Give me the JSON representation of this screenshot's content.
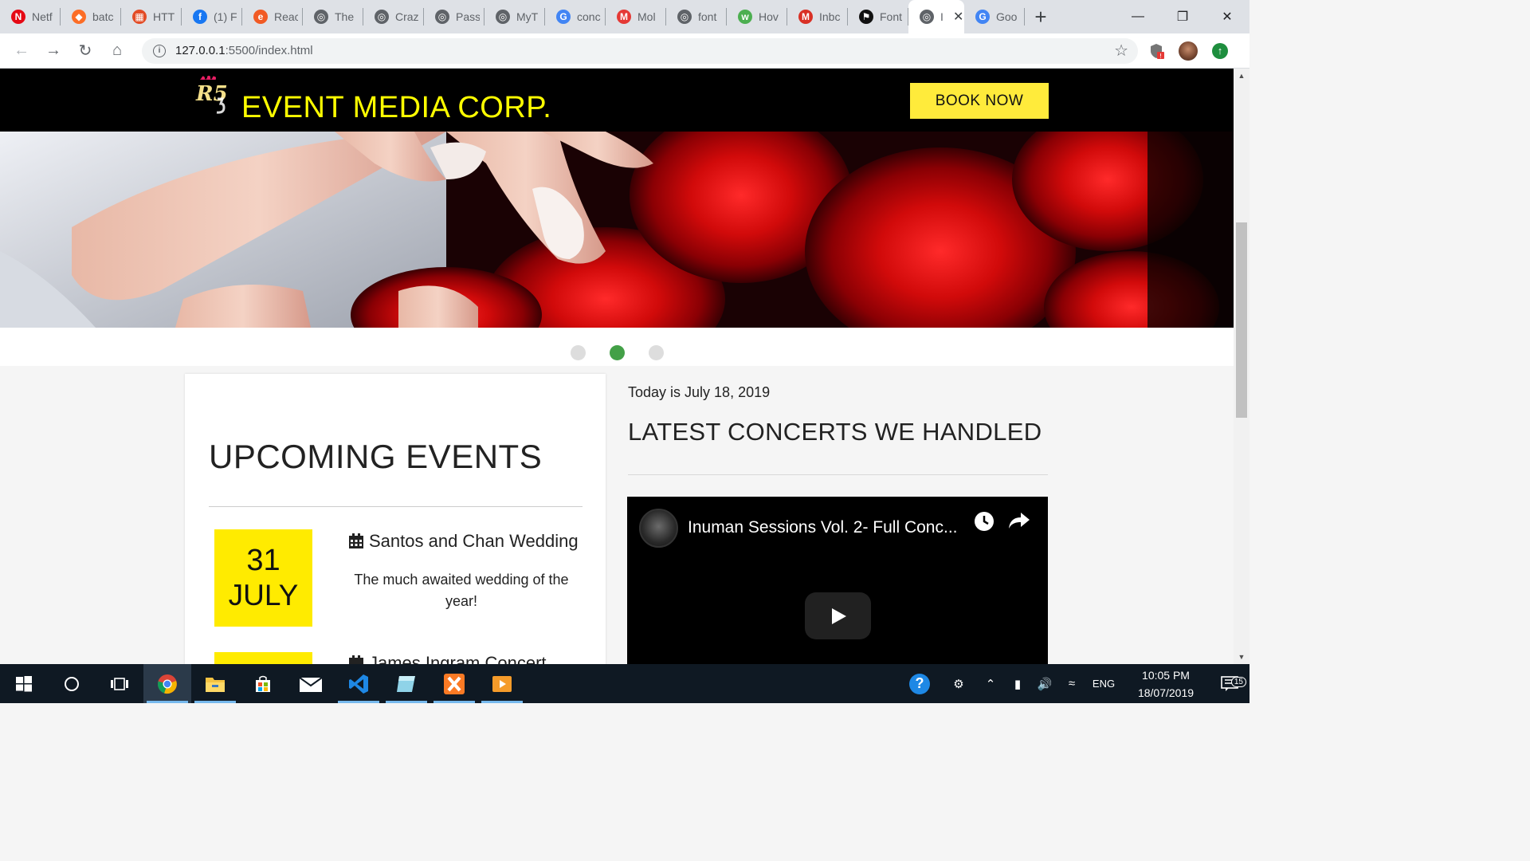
{
  "browser": {
    "tabs": [
      {
        "label": "Netf",
        "favicon": "netflix-icon",
        "color": "#e50914",
        "glyph": "N"
      },
      {
        "label": "batc",
        "favicon": "gitlab-icon",
        "color": "#fc6d26",
        "glyph": "◆"
      },
      {
        "label": "HTT",
        "favicon": "html-icon",
        "color": "#e34c26",
        "glyph": "▦"
      },
      {
        "label": "(1) F",
        "favicon": "facebook-icon",
        "color": "#1877f2",
        "glyph": "f"
      },
      {
        "label": "Reac",
        "favicon": "edureka-icon",
        "color": "#f15a24",
        "glyph": "e"
      },
      {
        "label": "The",
        "favicon": "globe-icon",
        "color": "#5f6368",
        "glyph": "◎"
      },
      {
        "label": "Craz",
        "favicon": "globe-icon",
        "color": "#5f6368",
        "glyph": "◎"
      },
      {
        "label": "Pass",
        "favicon": "globe-icon",
        "color": "#5f6368",
        "glyph": "◎"
      },
      {
        "label": "MyT",
        "favicon": "globe-icon",
        "color": "#5f6368",
        "glyph": "◎"
      },
      {
        "label": "conc",
        "favicon": "google-icon",
        "color": "#4285f4",
        "glyph": "G"
      },
      {
        "label": "Mol",
        "favicon": "mobirise-icon",
        "color": "#e53935",
        "glyph": "M"
      },
      {
        "label": "font",
        "favicon": "globe-icon",
        "color": "#5f6368",
        "glyph": "◎"
      },
      {
        "label": "Hov",
        "favicon": "w3schools-icon",
        "color": "#4caf50",
        "glyph": "w"
      },
      {
        "label": "Inbc",
        "favicon": "gmail-icon",
        "color": "#d93025",
        "glyph": "M"
      },
      {
        "label": "Font",
        "favicon": "fontawesome-icon",
        "color": "#111111",
        "glyph": "⚑"
      },
      {
        "label": "I",
        "favicon": "globe-icon",
        "color": "#5f6368",
        "glyph": "◎",
        "active": true
      },
      {
        "label": "Goo",
        "favicon": "google-icon",
        "color": "#4285f4",
        "glyph": "G"
      }
    ],
    "url": "127.0.0.1",
    "url_path": ":5500/index.html",
    "window_controls": [
      "—",
      "❐",
      "✕"
    ]
  },
  "site": {
    "brand": "EVENT MEDIA CORP.",
    "logo_text": "R5",
    "book_now": "BOOK NOW",
    "upcoming_title": "UPCOMING EVENTS",
    "events": [
      {
        "day": "31",
        "month": "JULY",
        "title": "Santos and Chan Wedding",
        "description": "The much awaited wedding of the year!"
      },
      {
        "day": "",
        "month": "",
        "title": "James Ingram Concert",
        "description": ""
      }
    ],
    "today": "Today is July 18, 2019",
    "latest_title": "LATEST CONCERTS WE HANDLED",
    "video_title": "Inuman Sessions Vol. 2- Full Conc...",
    "slider": {
      "count": 3,
      "active_index": 1,
      "active_color": "#43a047"
    }
  },
  "taskbar": {
    "apps": [
      "windows-start-icon",
      "cortana-icon",
      "task-view-icon",
      "chrome-icon",
      "file-explorer-icon",
      "store-icon",
      "mail-icon",
      "vscode-icon",
      "app-icon",
      "xampp-icon",
      "media-icon"
    ],
    "language": "ENG",
    "time": "10:05 PM",
    "date": "18/07/2019",
    "notifications": "15"
  },
  "colors": {
    "header_bg": "#000000",
    "brand_yellow": "#ffff00",
    "button_yellow": "#ffeb3b",
    "date_yellow": "#ffeb00"
  }
}
